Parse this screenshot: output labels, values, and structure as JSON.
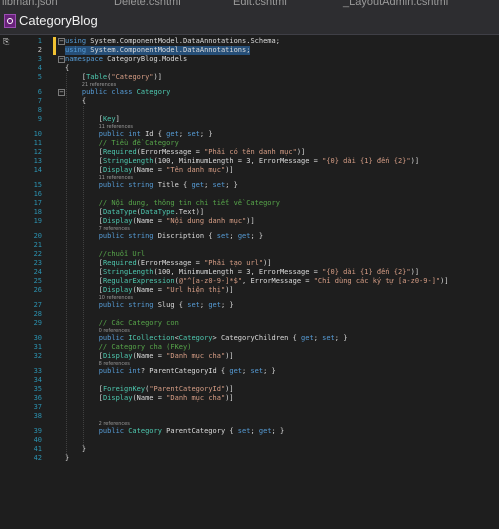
{
  "top_tabs": [
    "libman.json",
    "Delete.cshtml",
    "Edit.cshtml",
    "_LayoutAdmin.cshtml"
  ],
  "title": "CategoryBlog",
  "colors": {
    "keyword": "#569cd6",
    "type": "#4ec9b0",
    "string": "#d69d85",
    "comment": "#57a64a",
    "plain": "#dcdcdc",
    "line_number": "#2b91af",
    "selection": "#264f78",
    "change_bar": "#f1c232"
  },
  "lines": [
    {
      "n": "1",
      "fold": "minus",
      "segs": [
        {
          "t": "using",
          "c": "keyword"
        },
        {
          "t": " System.ComponentModel.DataAnnotations.Schema;",
          "c": "plain"
        }
      ]
    },
    {
      "n": "2",
      "current": true,
      "selected": true,
      "segs": [
        {
          "t": "using",
          "c": "keyword"
        },
        {
          "t": " System.ComponentModel.DataAnnotations;",
          "c": "plain"
        }
      ]
    },
    {
      "n": "3",
      "fold": "minus",
      "segs": [
        {
          "t": "namespace",
          "c": "keyword"
        },
        {
          "t": " CategoryBlog.Models",
          "c": "plain"
        }
      ]
    },
    {
      "n": "4",
      "segs": [
        {
          "t": "{",
          "c": "plain"
        }
      ]
    },
    {
      "n": "5",
      "segs": [
        {
          "t": "    [",
          "c": "plain"
        },
        {
          "t": "Table",
          "c": "type"
        },
        {
          "t": "(",
          "c": "plain"
        },
        {
          "t": "\"Category\"",
          "c": "string"
        },
        {
          "t": ")]",
          "c": "plain"
        }
      ]
    },
    {
      "ref": "21 references",
      "indent": 4
    },
    {
      "n": "6",
      "fold": "minus",
      "segs": [
        {
          "t": "    public class ",
          "c": "keyword"
        },
        {
          "t": "Category",
          "c": "type"
        }
      ]
    },
    {
      "n": "7",
      "segs": [
        {
          "t": "    {",
          "c": "plain"
        }
      ]
    },
    {
      "n": "8",
      "segs": []
    },
    {
      "n": "9",
      "segs": [
        {
          "t": "        [",
          "c": "plain"
        },
        {
          "t": "Key",
          "c": "type"
        },
        {
          "t": "]",
          "c": "plain"
        }
      ]
    },
    {
      "ref": "11 references",
      "indent": 8
    },
    {
      "n": "10",
      "segs": [
        {
          "t": "        public int ",
          "c": "keyword"
        },
        {
          "t": "Id { ",
          "c": "plain"
        },
        {
          "t": "get",
          "c": "keyword"
        },
        {
          "t": "; ",
          "c": "plain"
        },
        {
          "t": "set",
          "c": "keyword"
        },
        {
          "t": "; }",
          "c": "plain"
        }
      ]
    },
    {
      "n": "11",
      "segs": [
        {
          "t": "        // Tiều đề Category",
          "c": "comment"
        }
      ]
    },
    {
      "n": "12",
      "segs": [
        {
          "t": "        [",
          "c": "plain"
        },
        {
          "t": "Required",
          "c": "type"
        },
        {
          "t": "(ErrorMessage = ",
          "c": "plain"
        },
        {
          "t": "\"Phải có tên danh mục\"",
          "c": "string"
        },
        {
          "t": ")]",
          "c": "plain"
        }
      ]
    },
    {
      "n": "13",
      "segs": [
        {
          "t": "        [",
          "c": "plain"
        },
        {
          "t": "StringLength",
          "c": "type"
        },
        {
          "t": "(100, MinimumLength = 3, ErrorMessage = ",
          "c": "plain"
        },
        {
          "t": "\"{0} dài {1} đến {2}\"",
          "c": "string"
        },
        {
          "t": ")]",
          "c": "plain"
        }
      ]
    },
    {
      "n": "14",
      "segs": [
        {
          "t": "        [",
          "c": "plain"
        },
        {
          "t": "Display",
          "c": "type"
        },
        {
          "t": "(Name = ",
          "c": "plain"
        },
        {
          "t": "\"Tên danh mục\"",
          "c": "string"
        },
        {
          "t": ")]",
          "c": "plain"
        }
      ]
    },
    {
      "ref": "11 references",
      "indent": 8
    },
    {
      "n": "15",
      "segs": [
        {
          "t": "        public string ",
          "c": "keyword"
        },
        {
          "t": "Title { ",
          "c": "plain"
        },
        {
          "t": "get",
          "c": "keyword"
        },
        {
          "t": "; ",
          "c": "plain"
        },
        {
          "t": "set",
          "c": "keyword"
        },
        {
          "t": "; }",
          "c": "plain"
        }
      ]
    },
    {
      "n": "16",
      "segs": []
    },
    {
      "n": "17",
      "segs": [
        {
          "t": "        // Nội dung, thông tin chi tiết về Category",
          "c": "comment"
        }
      ]
    },
    {
      "n": "18",
      "segs": [
        {
          "t": "        [",
          "c": "plain"
        },
        {
          "t": "DataType",
          "c": "type"
        },
        {
          "t": "(",
          "c": "plain"
        },
        {
          "t": "DataType",
          "c": "type"
        },
        {
          "t": ".Text)]",
          "c": "plain"
        }
      ]
    },
    {
      "n": "19",
      "segs": [
        {
          "t": "        [",
          "c": "plain"
        },
        {
          "t": "Display",
          "c": "type"
        },
        {
          "t": "(Name = ",
          "c": "plain"
        },
        {
          "t": "\"Nội dung danh mục\"",
          "c": "string"
        },
        {
          "t": ")]",
          "c": "plain"
        }
      ]
    },
    {
      "ref": "7 references",
      "indent": 8
    },
    {
      "n": "20",
      "segs": [
        {
          "t": "        public string ",
          "c": "keyword"
        },
        {
          "t": "Discription { ",
          "c": "plain"
        },
        {
          "t": "set",
          "c": "keyword"
        },
        {
          "t": "; ",
          "c": "plain"
        },
        {
          "t": "get",
          "c": "keyword"
        },
        {
          "t": "; }",
          "c": "plain"
        }
      ]
    },
    {
      "n": "21",
      "segs": []
    },
    {
      "n": "22",
      "segs": [
        {
          "t": "        //chuỗi Url",
          "c": "comment"
        }
      ]
    },
    {
      "n": "23",
      "segs": [
        {
          "t": "        [",
          "c": "plain"
        },
        {
          "t": "Required",
          "c": "type"
        },
        {
          "t": "(ErrorMessage = ",
          "c": "plain"
        },
        {
          "t": "\"Phải tạo url\"",
          "c": "string"
        },
        {
          "t": ")]",
          "c": "plain"
        }
      ]
    },
    {
      "n": "24",
      "segs": [
        {
          "t": "        [",
          "c": "plain"
        },
        {
          "t": "StringLength",
          "c": "type"
        },
        {
          "t": "(100, MinimumLength = 3, ErrorMessage = ",
          "c": "plain"
        },
        {
          "t": "\"{0} dài {1} đến {2}\"",
          "c": "string"
        },
        {
          "t": ")]",
          "c": "plain"
        }
      ]
    },
    {
      "n": "25",
      "segs": [
        {
          "t": "        [",
          "c": "plain"
        },
        {
          "t": "RegularExpression",
          "c": "type"
        },
        {
          "t": "(",
          "c": "plain"
        },
        {
          "t": "@\"^[a-z0-9-]*$\"",
          "c": "string"
        },
        {
          "t": ", ErrorMessage = ",
          "c": "plain"
        },
        {
          "t": "\"Chỉ dùng các ký tự [a-z0-9-]\"",
          "c": "string"
        },
        {
          "t": ")]",
          "c": "plain"
        }
      ]
    },
    {
      "n": "26",
      "segs": [
        {
          "t": "        [",
          "c": "plain"
        },
        {
          "t": "Display",
          "c": "type"
        },
        {
          "t": "(Name = ",
          "c": "plain"
        },
        {
          "t": "\"Url hiện thị\"",
          "c": "string"
        },
        {
          "t": ")]",
          "c": "plain"
        }
      ]
    },
    {
      "ref": "10 references",
      "indent": 8
    },
    {
      "n": "27",
      "segs": [
        {
          "t": "        public string ",
          "c": "keyword"
        },
        {
          "t": "Slug { ",
          "c": "plain"
        },
        {
          "t": "set",
          "c": "keyword"
        },
        {
          "t": "; ",
          "c": "plain"
        },
        {
          "t": "get",
          "c": "keyword"
        },
        {
          "t": "; }",
          "c": "plain"
        }
      ]
    },
    {
      "n": "28",
      "segs": []
    },
    {
      "n": "29",
      "segs": [
        {
          "t": "        // Các Category con",
          "c": "comment"
        }
      ]
    },
    {
      "ref": "0 references",
      "indent": 8
    },
    {
      "n": "30",
      "segs": [
        {
          "t": "        public ",
          "c": "keyword"
        },
        {
          "t": "ICollection",
          "c": "type"
        },
        {
          "t": "<",
          "c": "plain"
        },
        {
          "t": "Category",
          "c": "type"
        },
        {
          "t": "> CategoryChildren { ",
          "c": "plain"
        },
        {
          "t": "get",
          "c": "keyword"
        },
        {
          "t": "; ",
          "c": "plain"
        },
        {
          "t": "set",
          "c": "keyword"
        },
        {
          "t": "; }",
          "c": "plain"
        }
      ]
    },
    {
      "n": "31",
      "segs": [
        {
          "t": "        // Category cha (FKey)",
          "c": "comment"
        }
      ]
    },
    {
      "n": "32",
      "segs": [
        {
          "t": "        [",
          "c": "plain"
        },
        {
          "t": "Display",
          "c": "type"
        },
        {
          "t": "(Name = ",
          "c": "plain"
        },
        {
          "t": "\"Danh mục cha\"",
          "c": "string"
        },
        {
          "t": ")]",
          "c": "plain"
        }
      ]
    },
    {
      "ref": "8 references",
      "indent": 8
    },
    {
      "n": "33",
      "segs": [
        {
          "t": "        public int",
          "c": "keyword"
        },
        {
          "t": "? ParentCategoryId { ",
          "c": "plain"
        },
        {
          "t": "get",
          "c": "keyword"
        },
        {
          "t": "; ",
          "c": "plain"
        },
        {
          "t": "set",
          "c": "keyword"
        },
        {
          "t": "; }",
          "c": "plain"
        }
      ]
    },
    {
      "n": "34",
      "segs": []
    },
    {
      "n": "35",
      "segs": [
        {
          "t": "        [",
          "c": "plain"
        },
        {
          "t": "ForeignKey",
          "c": "type"
        },
        {
          "t": "(",
          "c": "plain"
        },
        {
          "t": "\"ParentCategoryId\"",
          "c": "string"
        },
        {
          "t": ")]",
          "c": "plain"
        }
      ]
    },
    {
      "n": "36",
      "segs": [
        {
          "t": "        [",
          "c": "plain"
        },
        {
          "t": "Display",
          "c": "type"
        },
        {
          "t": "(Name = ",
          "c": "plain"
        },
        {
          "t": "\"Danh mục cha\"",
          "c": "string"
        },
        {
          "t": ")]",
          "c": "plain"
        }
      ]
    },
    {
      "n": "37",
      "segs": []
    },
    {
      "n": "38",
      "segs": []
    },
    {
      "ref": "2 references",
      "indent": 8
    },
    {
      "n": "39",
      "segs": [
        {
          "t": "        public ",
          "c": "keyword"
        },
        {
          "t": "Category",
          "c": "type"
        },
        {
          "t": " ParentCategory { ",
          "c": "plain"
        },
        {
          "t": "set",
          "c": "keyword"
        },
        {
          "t": "; ",
          "c": "plain"
        },
        {
          "t": "get",
          "c": "keyword"
        },
        {
          "t": "; }",
          "c": "plain"
        }
      ]
    },
    {
      "n": "40",
      "segs": []
    },
    {
      "n": "41",
      "segs": [
        {
          "t": "    }",
          "c": "plain"
        }
      ]
    },
    {
      "n": "42",
      "segs": [
        {
          "t": "}",
          "c": "plain"
        }
      ]
    }
  ]
}
